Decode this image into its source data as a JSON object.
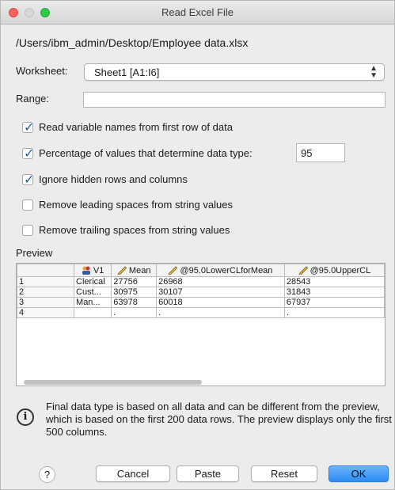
{
  "window": {
    "title": "Read Excel File"
  },
  "file": {
    "path": "/Users/ibm_admin/Desktop/Employee data.xlsx"
  },
  "worksheet": {
    "label": "Worksheet:",
    "value": "Sheet1 [A1:I6]"
  },
  "range": {
    "label": "Range:",
    "value": ""
  },
  "options": [
    {
      "label": "Read variable names from first row of data",
      "checked": true
    },
    {
      "label": "Percentage of values that determine data type:",
      "checked": true
    },
    {
      "label": "Ignore hidden rows and columns",
      "checked": true
    },
    {
      "label": "Remove leading spaces from string values",
      "checked": false
    },
    {
      "label": "Remove trailing spaces from string values",
      "checked": false
    }
  ],
  "percentage": {
    "value": "95"
  },
  "preview": {
    "label": "Preview",
    "columns": [
      {
        "name": "V1",
        "icon": "nominal-icon"
      },
      {
        "name": "Mean",
        "icon": "scale-ruler-icon"
      },
      {
        "name": "@95.0LowerCLforMean",
        "icon": "scale-ruler-icon"
      },
      {
        "name": "@95.0UpperCL",
        "icon": "scale-ruler-icon"
      }
    ],
    "rows": [
      [
        "1",
        "Clerical",
        "27756",
        "26968",
        "28543"
      ],
      [
        "2",
        "Cust...",
        "30975",
        "30107",
        "31843"
      ],
      [
        "3",
        "Man...",
        "63978",
        "60018",
        "67937"
      ],
      [
        "4",
        "",
        ".",
        ".",
        "."
      ]
    ]
  },
  "info": {
    "text": "Final data type is based on all data and can be different from the preview, which is based on the first 200 data rows. The preview displays only the first 500 columns."
  },
  "buttons": {
    "help": "?",
    "cancel": "Cancel",
    "paste": "Paste",
    "reset": "Reset",
    "ok": "OK"
  },
  "colors": {
    "accent": "#2b8ef5",
    "checkmark": "#1e58c9"
  }
}
